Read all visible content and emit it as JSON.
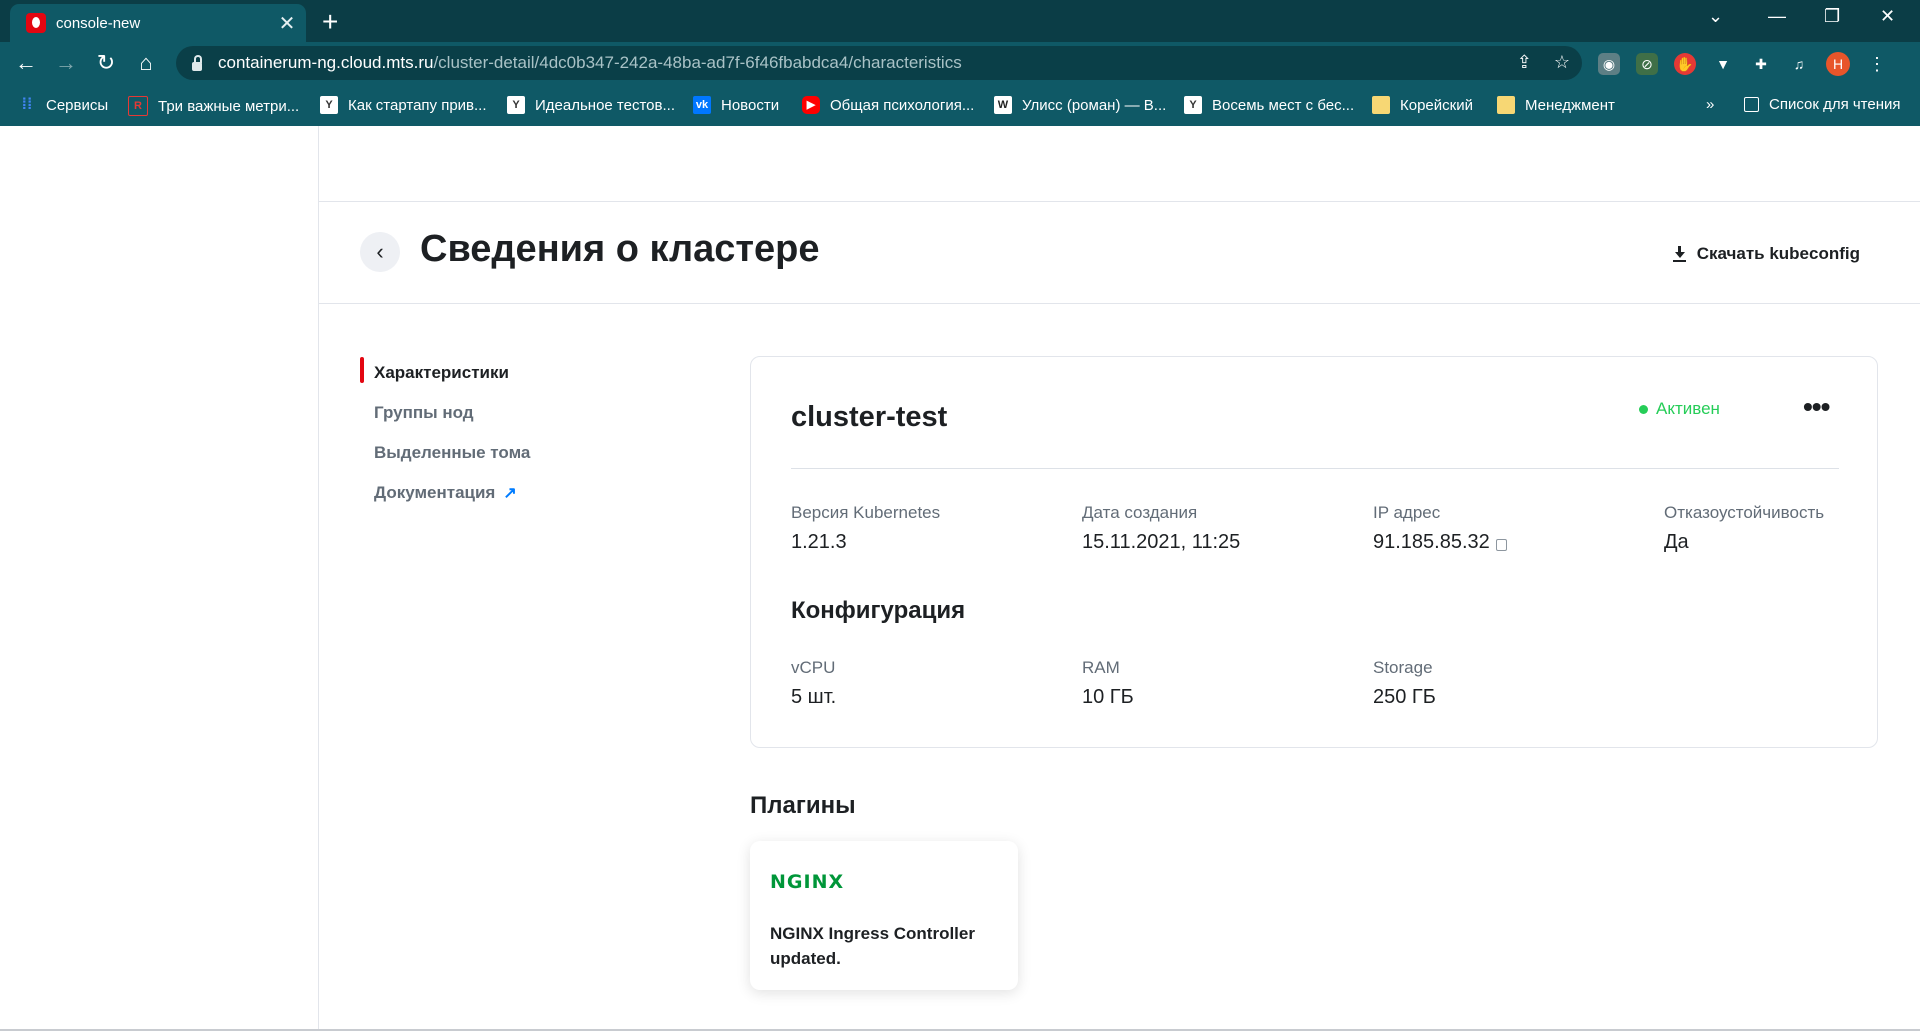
{
  "browser": {
    "tab_title": "console-new",
    "tab_close": "✕",
    "new_tab": "+",
    "url_host": "containerum-ng.cloud.mts.ru",
    "url_path": "/cluster-detail/4dc0b347-242a-48ba-ad7f-6f46fbabdca4/characteristics",
    "profile_initial": "Н",
    "controls": {
      "minimize": "⌄",
      "min": "—",
      "restore": "❐",
      "close": "✕"
    }
  },
  "bookmarks": [
    {
      "label": "Сервисы",
      "icon": "apps-grid-icon",
      "color": "#4285f4"
    },
    {
      "label": "Три важные метри...",
      "icon": "rc-icon",
      "color": "#e53935"
    },
    {
      "label": "Как стартапу прив...",
      "icon": "yc-icon",
      "color": "#ffffff"
    },
    {
      "label": "Идеальное тестов...",
      "icon": "yc-icon",
      "color": "#ffffff"
    },
    {
      "label": "Новости",
      "icon": "vk-icon",
      "color": "#0077ff"
    },
    {
      "label": "Общая психология...",
      "icon": "youtube-icon",
      "color": "#ff0000"
    },
    {
      "label": "Улисс (роман) — В...",
      "icon": "wikipedia-icon",
      "color": "#ffffff"
    },
    {
      "label": "Восемь мест с бес...",
      "icon": "yc-icon",
      "color": "#ffffff"
    },
    {
      "label": "Корейский",
      "icon": "folder-icon",
      "color": "#f7d774"
    },
    {
      "label": "Менеджмент",
      "icon": "folder-icon",
      "color": "#f7d774"
    }
  ],
  "bookmarks_more": "»",
  "reading_list": "Список для чтения",
  "header": {
    "title": "Сведения о кластере",
    "download_label": "Скачать kubeconfig"
  },
  "subnav": [
    {
      "label": "Характеристики",
      "active": true
    },
    {
      "label": "Группы нод",
      "active": false
    },
    {
      "label": "Выделенные тома",
      "active": false
    },
    {
      "label": "Документация",
      "active": false,
      "external": true
    }
  ],
  "cluster": {
    "name": "cluster-test",
    "status": "Активен",
    "status_color": "#26cd58",
    "details": [
      {
        "label": "Версия Kubernetes",
        "value": "1.21.3"
      },
      {
        "label": "Дата создания",
        "value": "15.11.2021, 11:25"
      },
      {
        "label": "IP адрес",
        "value": "91.185.85.32"
      },
      {
        "label": "Отказоустойчивость",
        "value": "Да"
      }
    ],
    "config_title": "Конфигурация",
    "config": [
      {
        "label": "vCPU",
        "value": "5 шт."
      },
      {
        "label": "RAM",
        "value": "10 ГБ"
      },
      {
        "label": "Storage",
        "value": "250 ГБ"
      }
    ]
  },
  "plugins": {
    "title": "Плагины",
    "items": [
      {
        "logo": "NGINX",
        "description": "NGINX Ingress Controller updated."
      }
    ]
  },
  "colors": {
    "accent_red": "#e30611",
    "chrome_bg": "#0f5966",
    "link_blue": "#007cff"
  }
}
